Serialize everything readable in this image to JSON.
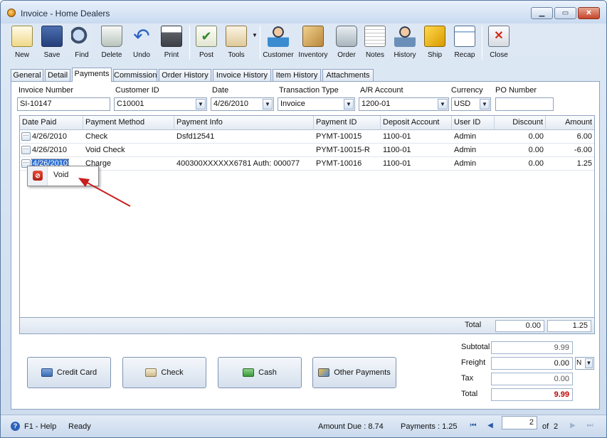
{
  "window": {
    "title": "Invoice - Home Dealers",
    "minimize": "▁",
    "maximize": "▭",
    "close": "✕"
  },
  "toolbar": [
    {
      "label": "New",
      "icon": "new-icon"
    },
    {
      "label": "Save",
      "icon": "save-icon"
    },
    {
      "label": "Find",
      "icon": "find-icon"
    },
    {
      "label": "Delete",
      "icon": "delete-icon"
    },
    {
      "label": "Undo",
      "icon": "undo-icon"
    },
    {
      "label": "Print",
      "icon": "print-icon"
    },
    {
      "label": "Post",
      "icon": "post-icon"
    },
    {
      "label": "Tools",
      "icon": "tools-icon"
    },
    {
      "label": "Customer",
      "icon": "customer-icon"
    },
    {
      "label": "Inventory",
      "icon": "inventory-icon"
    },
    {
      "label": "Order",
      "icon": "order-icon"
    },
    {
      "label": "Notes",
      "icon": "notes-icon"
    },
    {
      "label": "History",
      "icon": "history-icon"
    },
    {
      "label": "Ship",
      "icon": "ship-icon"
    },
    {
      "label": "Recap",
      "icon": "recap-icon"
    },
    {
      "label": "Close",
      "icon": "close-icon"
    }
  ],
  "tabs": [
    "General",
    "Detail",
    "Payments",
    "Commission",
    "Order History",
    "Invoice History",
    "Item History",
    "Attachments"
  ],
  "active_tab": "Payments",
  "header_fields": {
    "invoice_number": {
      "label": "Invoice Number",
      "value": "SI-10147"
    },
    "customer_id": {
      "label": "Customer ID",
      "value": "C10001"
    },
    "date": {
      "label": "Date",
      "value": "4/26/2010"
    },
    "transaction_type": {
      "label": "Transaction Type",
      "value": "Invoice"
    },
    "ar_account": {
      "label": "A/R Account",
      "value": "1200-01"
    },
    "currency": {
      "label": "Currency",
      "value": "USD"
    },
    "po_number": {
      "label": "PO Number",
      "value": ""
    }
  },
  "grid": {
    "columns": [
      "Date Paid",
      "Payment Method",
      "Payment Info",
      "Payment ID",
      "Deposit Account",
      "User ID",
      "Discount",
      "Amount"
    ],
    "rows": [
      {
        "date_paid": "4/26/2010",
        "method": "Check",
        "info": "Dsfd12541",
        "payment_id": "PYMT-10015",
        "deposit": "1100-01",
        "user": "Admin",
        "discount": "0.00",
        "amount": "6.00"
      },
      {
        "date_paid": "4/26/2010",
        "method": "Void Check",
        "info": "",
        "payment_id": "PYMT-10015-R",
        "deposit": "1100-01",
        "user": "Admin",
        "discount": "0.00",
        "amount": "-6.00"
      },
      {
        "date_paid": "4/26/2010",
        "method": "Charge",
        "info": "400300XXXXXX6781 Auth: 000077",
        "payment_id": "PYMT-10016",
        "deposit": "1100-01",
        "user": "Admin",
        "discount": "0.00",
        "amount": "1.25"
      }
    ],
    "total_label": "Total",
    "total_discount": "0.00",
    "total_amount": "1.25"
  },
  "context_menu": {
    "items": [
      {
        "label": "Void",
        "icon": "void-icon"
      }
    ]
  },
  "payment_buttons": [
    "Credit Card",
    "Check",
    "Cash",
    "Other Payments"
  ],
  "summary": {
    "subtotal": {
      "label": "Subtotal",
      "value": "9.99"
    },
    "freight": {
      "label": "Freight",
      "value": "0.00",
      "option": "N"
    },
    "tax": {
      "label": "Tax",
      "value": "0.00"
    },
    "total": {
      "label": "Total",
      "value": "9.99"
    }
  },
  "status_bar": {
    "help": "F1 - Help",
    "status": "Ready",
    "amount_due": "Amount Due : 8.74",
    "payments": "Payments : 1.25",
    "page": "2",
    "page_of": "of",
    "page_total": "2"
  },
  "colors": {
    "accent": "#2f6fd0",
    "total_red": "#c00000",
    "arrow": "#c81e1e"
  }
}
